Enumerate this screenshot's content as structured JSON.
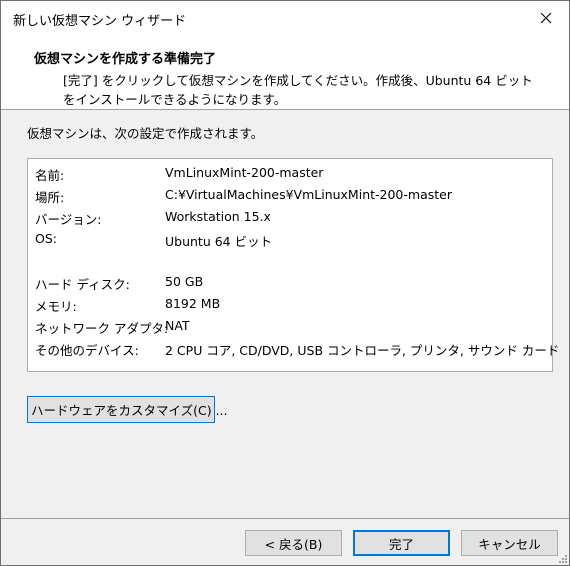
{
  "window": {
    "title": "新しい仮想マシン ウィザード"
  },
  "header": {
    "title": "仮想マシンを作成する準備完了",
    "desc_line1": "[完了] をクリックして仮想マシンを作成してください。作成後、Ubuntu 64 ビット",
    "desc_line2": "をインストールできるようになります。"
  },
  "intro": "仮想マシンは、次の設定で作成されます。",
  "summary": [
    {
      "label": "名前:",
      "value": "VmLinuxMint-200-master"
    },
    {
      "label": "場所:",
      "value": "C:¥VirtualMachines¥VmLinuxMint-200-master"
    },
    {
      "label": "バージョン:",
      "value": "Workstation 15.x"
    },
    {
      "label": "OS:",
      "value": "Ubuntu 64 ビット"
    },
    {
      "label": "ハード ディスク:",
      "value": "50 GB"
    },
    {
      "label": "メモリ:",
      "value": "8192 MB"
    },
    {
      "label": "ネットワーク アダプタ:",
      "value": "NAT"
    },
    {
      "label": "その他のデバイス:",
      "value": "2 CPU コア, CD/DVD, USB コントローラ, プリンタ, サウンド カード"
    }
  ],
  "buttons": {
    "customize": "ハードウェアをカスタマイズ(C) ...",
    "back": "< 戻る(B)",
    "finish": "完了",
    "cancel": "キャンセル"
  }
}
